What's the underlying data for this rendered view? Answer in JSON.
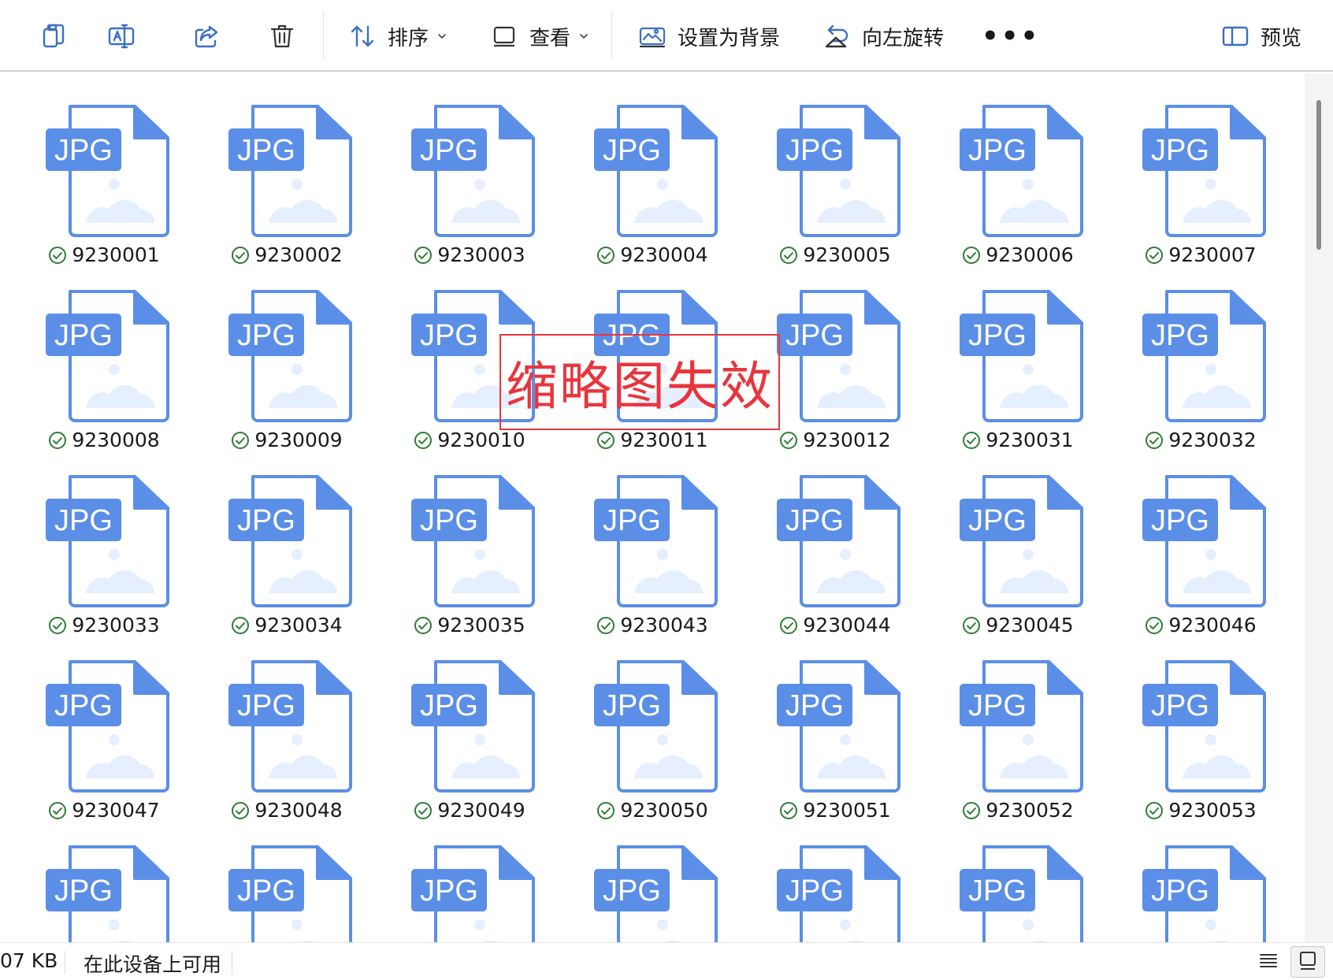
{
  "toolbar": {
    "icons": [
      "copy-icon",
      "rename-icon",
      "share-icon",
      "delete-icon"
    ],
    "sort_label": "排序",
    "view_label": "查看",
    "set_background_label": "设置为背景",
    "rotate_left_label": "向左旋转",
    "more_label": "•••",
    "preview_label": "预览"
  },
  "files": {
    "type_label": "JPG",
    "sync_status": "available-on-device",
    "items": [
      "9230001",
      "9230002",
      "9230003",
      "9230004",
      "9230005",
      "9230006",
      "9230007",
      "9230008",
      "9230009",
      "9230010",
      "9230011",
      "9230012",
      "9230031",
      "9230032",
      "9230033",
      "9230034",
      "9230035",
      "9230043",
      "9230044",
      "9230045",
      "9230046",
      "9230047",
      "9230048",
      "9230049",
      "9230050",
      "9230051",
      "9230052",
      "9230053",
      "",
      "",
      "",
      "",
      "",
      "",
      ""
    ]
  },
  "annotation": {
    "text": "缩略图失效"
  },
  "statusbar": {
    "size_text": "07 KB",
    "availability_text": "在此设备上可用"
  },
  "colors": {
    "file_blue": "#5b8ee6",
    "file_fill": "#ffffff",
    "file_pale": "#e6efff",
    "check_green": "#2e7d32",
    "annotation_red": "#e8353d"
  }
}
